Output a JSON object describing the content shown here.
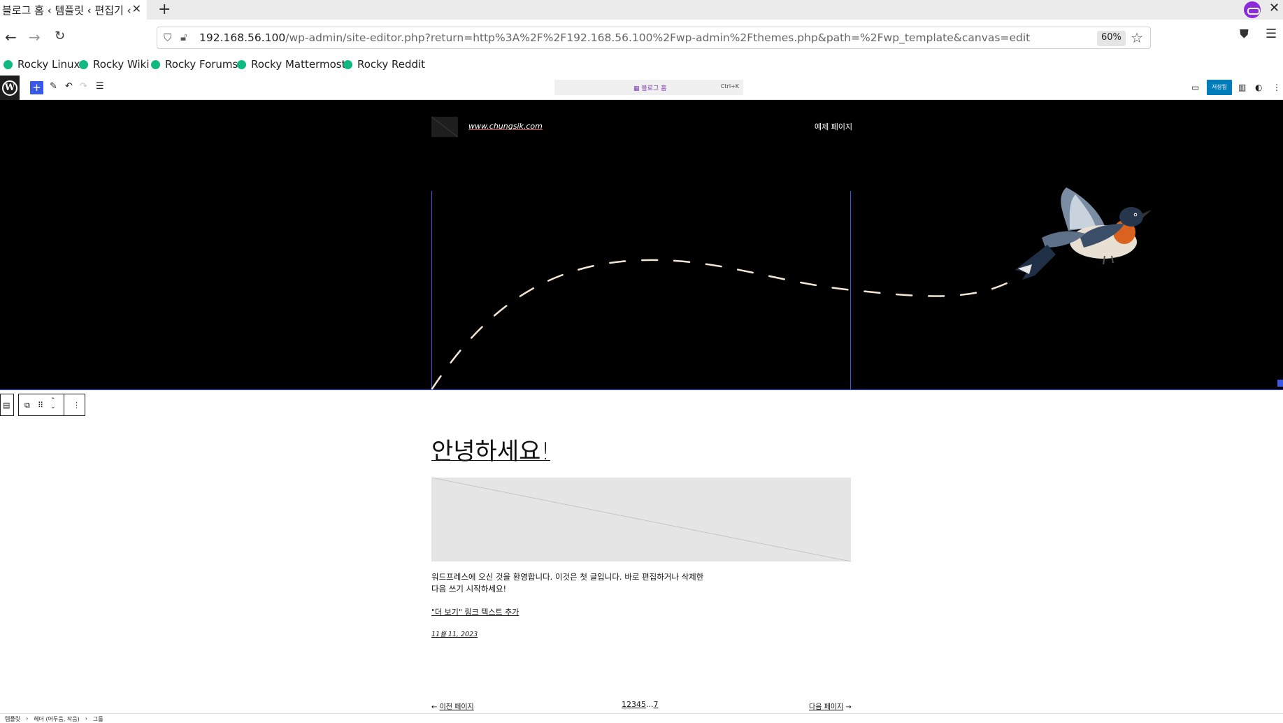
{
  "browser": {
    "tab_title": "블로그 홈 ‹ 템플릿 ‹ 편집기 ‹ ",
    "tab_title_fade": "W",
    "url_host": "192.168.56.100",
    "url_path": "/wp-admin/site-editor.php?return=http%3A%2F%2F192.168.56.100%2Fwp-admin%2Fthemes.php&path=%2Fwp_template&canvas=edit",
    "zoom": "60%",
    "bookmarks": [
      "Rocky Linux",
      "Rocky Wiki",
      "Rocky Forums",
      "Rocky Mattermost",
      "Rocky Reddit"
    ]
  },
  "editor": {
    "command_label": "블로그 홈",
    "command_shortcut": "Ctrl+K",
    "save_label": "저장됨"
  },
  "canvas": {
    "site_url": "www.chungsik.com",
    "nav_link": "예제 페이지",
    "post_title": "안녕하세요!",
    "excerpt": "워드프레스에 오신 것을 환영합니다. 이것은 첫 글입니다. 바로 편집하거나 삭제한 다음 쓰기 시작하세요!",
    "more_link": "\"더 보기\" 링크 텍스트 추가",
    "post_date": "11월 11, 2023",
    "pagination": {
      "prev": "이전 페이지",
      "pages": [
        "1",
        "2",
        "3",
        "4",
        "5",
        "...",
        "7"
      ],
      "next": "다음 페이지"
    }
  },
  "breadcrumb": [
    "템플릿",
    "헤더 (어두움, 작음)",
    "그룹"
  ],
  "colors": {
    "wp_blue": "#3858e9",
    "save_blue": "#007cba",
    "bookmark_green": "#10b981",
    "header_bg": "#000000"
  }
}
